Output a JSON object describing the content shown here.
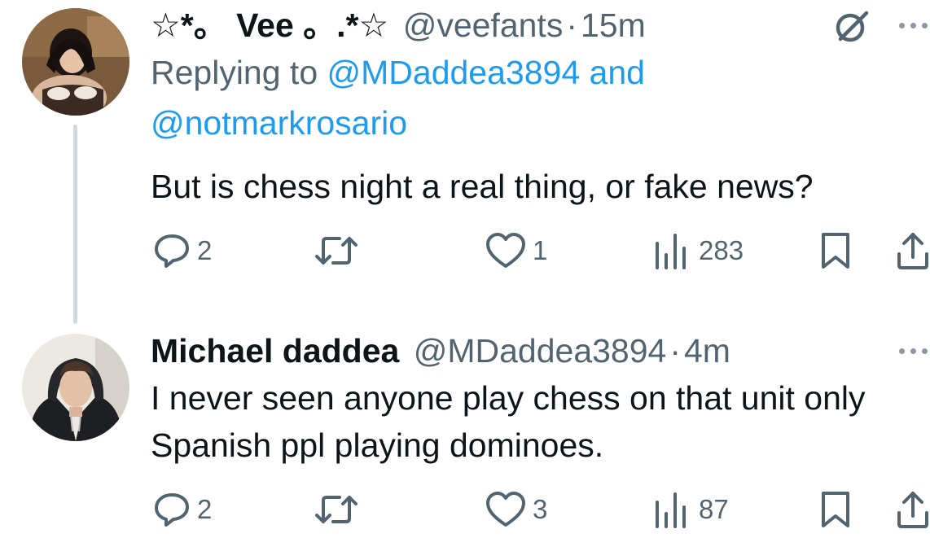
{
  "tweets": [
    {
      "display_name": "☆*。 Vee 。.*☆",
      "handle": "@veefants",
      "separator": "·",
      "time": "15m",
      "replying_prefix": "Replying to ",
      "replying_user_1": "@MDaddea3894",
      "replying_conj": " and",
      "replying_user_2": "@notmarkrosario",
      "text": "But is chess night a real thing, or fake news?",
      "stats": {
        "replies": "2",
        "retweets": "",
        "likes": "1",
        "views": "283"
      },
      "icons": [
        "reply-icon",
        "retweet-icon",
        "like-icon",
        "views-icon",
        "bookmark-icon",
        "share-icon",
        "grok-icon",
        "more-icon"
      ]
    },
    {
      "display_name": "Michael daddea",
      "handle": "@MDaddea3894",
      "separator": "·",
      "time": "4m",
      "text": "I never seen anyone play chess on that unit only Spanish ppl playing dominoes.",
      "stats": {
        "replies": "2",
        "retweets": "",
        "likes": "3",
        "views": "87"
      },
      "icons": [
        "reply-icon",
        "retweet-icon",
        "like-icon",
        "views-icon",
        "bookmark-icon",
        "share-icon",
        "more-icon"
      ]
    }
  ],
  "colors": {
    "text": "#0f1419",
    "muted": "#536471",
    "link": "#1d9bf0",
    "thread_line": "#cfd9de",
    "background": "#ffffff"
  }
}
